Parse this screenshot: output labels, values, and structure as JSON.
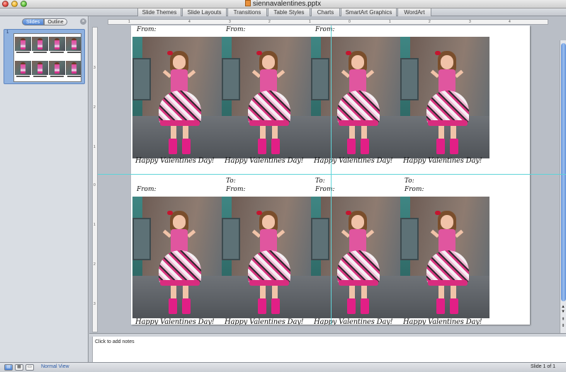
{
  "window": {
    "title": "siennavalentines.pptx"
  },
  "ribbon": {
    "tabs": [
      "Slide Themes",
      "Slide Layouts",
      "Transitions",
      "Table Styles",
      "Charts",
      "SmartArt Graphics",
      "WordArt"
    ]
  },
  "left_panel": {
    "slides_tab": "Slides",
    "outline_tab": "Outline",
    "close_glyph": "×",
    "slide_number": "1"
  },
  "ruler": {
    "h_ticks": [
      "1",
      "4",
      "3",
      "2",
      "1",
      "0",
      "1",
      "2",
      "3",
      "4"
    ],
    "v_ticks": [
      "3",
      "2",
      "1",
      "0",
      "1",
      "2",
      "3"
    ]
  },
  "slide": {
    "cards": [
      {
        "to": "",
        "from": "From:",
        "caption": "Happy Valentines Day!"
      },
      {
        "to": "",
        "from": "From:",
        "caption": "Happy Valentines Day!"
      },
      {
        "to": "",
        "from": "From:",
        "caption": "Happy Valentines Day!"
      },
      {
        "to": "",
        "from": "",
        "caption": "Happy Valentines Day!"
      },
      {
        "to": "",
        "from": "From:",
        "caption": "Happy Valentines Day!"
      },
      {
        "to": "To:",
        "from": "From:",
        "caption": "Happy Valentines Day!"
      },
      {
        "to": "To:",
        "from": "From:",
        "caption": "Happy Valentines Day!"
      },
      {
        "to": "To:",
        "from": "From:",
        "caption": "Happy Valentines Day!"
      }
    ]
  },
  "notes": {
    "placeholder": "Click to add notes"
  },
  "statusbar": {
    "view_label": "Normal View",
    "slide_count": "Slide 1 of 1"
  }
}
